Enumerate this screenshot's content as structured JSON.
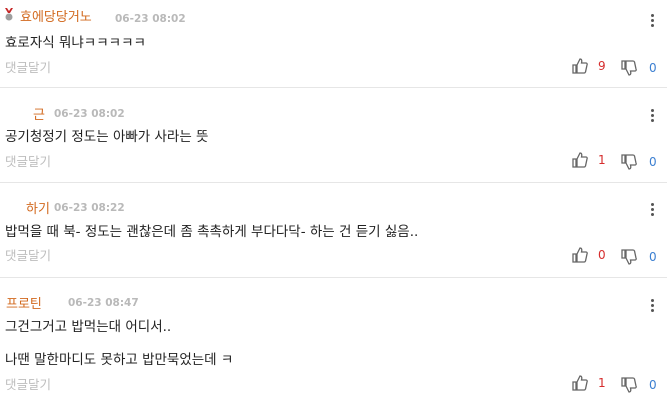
{
  "colors": {
    "nickname": "#d2691e",
    "like_count": "#d62d2d",
    "dislike_count": "#3b7fd1",
    "timestamp": "#b9b9b9",
    "reply": "#bdbdbd"
  },
  "comments": [
    {
      "nickname": "효에당당거노",
      "time": "06-23 08:02",
      "lines": [
        "효로자식 뭐냐ㅋㅋㅋㅋㅋ"
      ],
      "reply_label": "댓글달기",
      "likes": "9",
      "dislikes": "0",
      "badge": "medal-icon"
    },
    {
      "nickname": "근",
      "time": "06-23 08:02",
      "lines": [
        "공기청정기 정도는 아빠가 사라는 뜻"
      ],
      "reply_label": "댓글달기",
      "likes": "1",
      "dislikes": "0"
    },
    {
      "nickname": "하기",
      "time": "06-23 08:22",
      "lines": [
        "밥먹을 때 북- 정도는 괜찮은데 좀 촉촉하게 부다다닥- 하는 건 듣기 싫음.."
      ],
      "reply_label": "댓글달기",
      "likes": "0",
      "dislikes": "0"
    },
    {
      "nickname": "프로틴",
      "time": "06-23 08:47",
      "lines": [
        "그건그거고 밥먹는대 어디서..",
        "나땐 말한마디도 못하고 밥만묵었는데 ㅋ"
      ],
      "reply_label": "댓글달기",
      "likes": "1",
      "dislikes": "0"
    }
  ]
}
